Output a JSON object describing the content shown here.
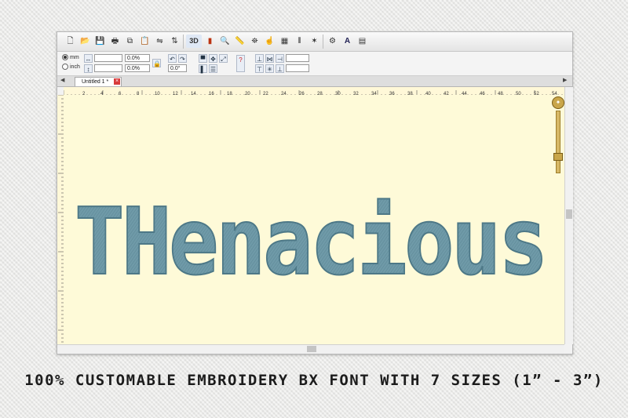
{
  "toolbar": {
    "buttons": [
      {
        "name": "new-file-icon",
        "glyph": "🗋"
      },
      {
        "name": "open-folder-icon",
        "glyph": "📂"
      },
      {
        "name": "save-icon",
        "glyph": "💾"
      },
      {
        "name": "print-icon",
        "glyph": "🖶"
      },
      {
        "name": "copy-icon",
        "glyph": "⧉"
      },
      {
        "name": "paste-icon",
        "glyph": "📋"
      },
      {
        "name": "mirror-horizontal-icon",
        "glyph": "⇋"
      },
      {
        "name": "mirror-vertical-icon",
        "glyph": "⇅"
      },
      {
        "name": "view-3d-button",
        "glyph": "3D"
      },
      {
        "name": "color-bars-icon",
        "glyph": "▮"
      },
      {
        "name": "zoom-icon",
        "glyph": "🔍"
      },
      {
        "name": "measure-ruler-icon",
        "glyph": "📏"
      },
      {
        "name": "hoop-icon",
        "glyph": "⛯"
      },
      {
        "name": "select-hand-icon",
        "glyph": "☝"
      },
      {
        "name": "properties-icon",
        "glyph": "▦"
      },
      {
        "name": "thread-spools-icon",
        "glyph": "⫴"
      },
      {
        "name": "network-icon",
        "glyph": "✶"
      },
      {
        "name": "color-settings-icon",
        "glyph": "⚙"
      },
      {
        "name": "text-tool-icon",
        "glyph": "A"
      },
      {
        "name": "monogram-icon",
        "glyph": "▤"
      }
    ]
  },
  "units": {
    "mm_label": "mm",
    "inch_label": "inch"
  },
  "fields": {
    "width_pct": "0.0%",
    "height_pct": "0.0%",
    "rotation": "0.0°"
  },
  "tab": {
    "label": "Untitled 1 *"
  },
  "ruler": {
    "labels": [
      "2",
      "4",
      "6",
      "8",
      "10",
      "12",
      "14",
      "16",
      "18",
      "20",
      "22",
      "24",
      "26",
      "28",
      "30",
      "32",
      "34",
      "36",
      "38",
      "40",
      "42",
      "44",
      "46",
      "48",
      "50",
      "52",
      "54",
      "56",
      "58",
      "60"
    ]
  },
  "design": {
    "text": "THenacious",
    "fill": "#6f9aa8",
    "stroke": "#4d7887"
  },
  "caption": "100% CUSTOMABLE EMBROIDERY BX FONT WITH 7 SIZES (1” -  3”)"
}
